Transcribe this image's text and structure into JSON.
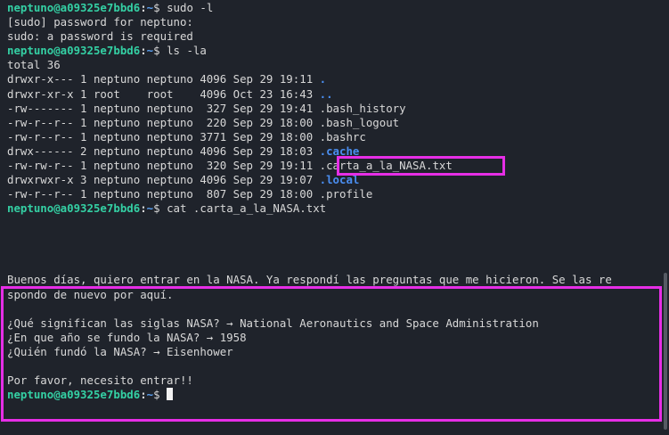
{
  "terminal": {
    "prompt_user": "neptuno@a09325e7bbd6",
    "prompt_sep": ":",
    "prompt_path": "~",
    "prompt_symbol": "$",
    "cmd1": "sudo -l",
    "out1a": "[sudo] password for neptuno:",
    "out1b": "sudo: a password is required",
    "cmd2": "ls -la",
    "total": "total 36",
    "listing": [
      {
        "meta": "drwxr-x--- 1 neptuno neptuno 4096 Sep 29 19:11 ",
        "name": ".",
        "is_dir": true
      },
      {
        "meta": "drwxr-xr-x 1 root    root    4096 Oct 23 16:43 ",
        "name": "..",
        "is_dir": true
      },
      {
        "meta": "-rw------- 1 neptuno neptuno  327 Sep 29 19:41 ",
        "name": ".bash_history",
        "is_dir": false
      },
      {
        "meta": "-rw-r--r-- 1 neptuno neptuno  220 Sep 29 18:00 ",
        "name": ".bash_logout",
        "is_dir": false
      },
      {
        "meta": "-rw-r--r-- 1 neptuno neptuno 3771 Sep 29 18:00 ",
        "name": ".bashrc",
        "is_dir": false
      },
      {
        "meta": "drwx------ 2 neptuno neptuno 4096 Sep 29 18:03 ",
        "name": ".cache",
        "is_dir": true
      },
      {
        "meta": "-rw-rw-r-- 1 neptuno neptuno  320 Sep 29 19:11 ",
        "name": ".carta_a_la_NASA.txt",
        "is_dir": false
      },
      {
        "meta": "drwxrwxr-x 3 neptuno neptuno 4096 Sep 29 19:07 ",
        "name": ".local",
        "is_dir": true
      },
      {
        "meta": "-rw-r--r-- 1 neptuno neptuno  807 Sep 29 18:00 ",
        "name": ".profile",
        "is_dir": false
      }
    ],
    "cmd3": "cat .carta_a_la_NASA.txt",
    "letter": [
      "Buenos días, quiero entrar en la NASA. Ya respondí las preguntas que me hicieron. Se las re",
      "spondo de nuevo por aquí.",
      "",
      "¿Qué significan las siglas NASA? → National Aeronautics and Space Administration",
      "¿En que año se fundo la NASA? → 1958",
      "¿Quién fundó la NASA? → Eisenhower",
      "",
      "Por favor, necesito entrar!!"
    ]
  },
  "colors": {
    "background": "#1f232b",
    "prompt_user": "#34d0a4",
    "directory": "#4a8ef0",
    "highlight": "#e62ee6"
  }
}
